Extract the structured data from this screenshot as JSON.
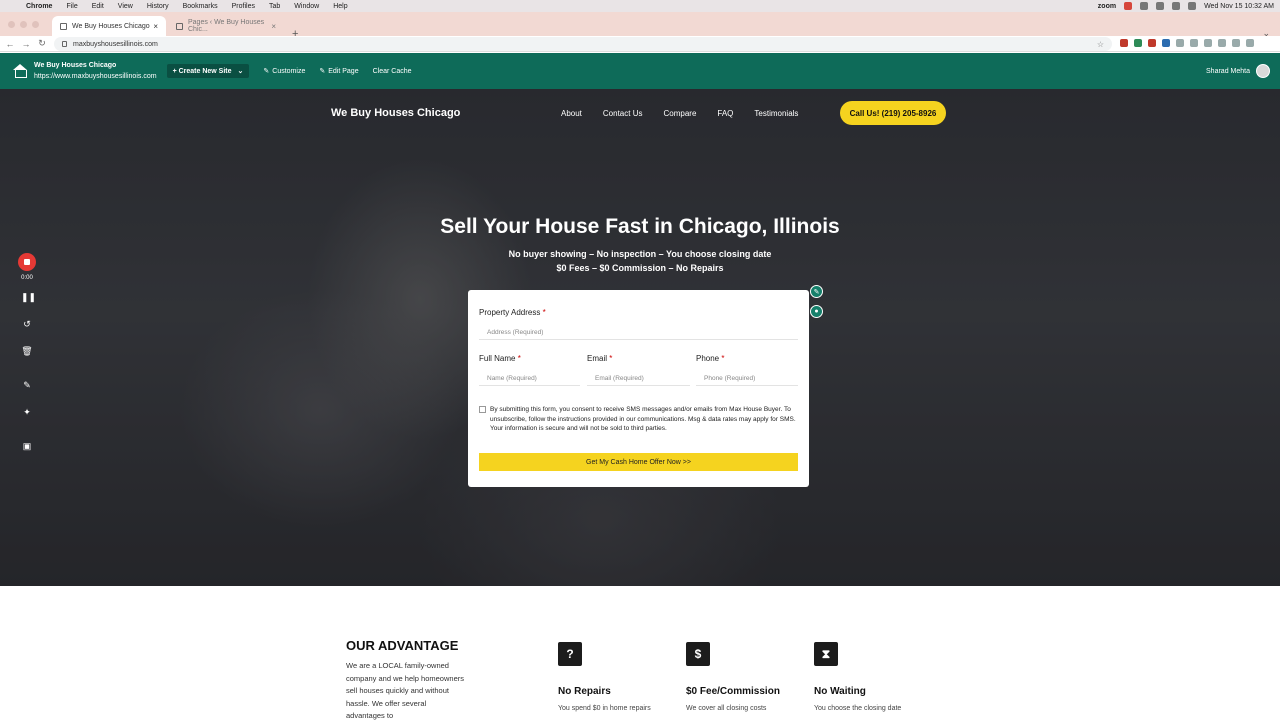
{
  "menubar": {
    "app": "Chrome",
    "items": [
      "File",
      "Edit",
      "View",
      "History",
      "Bookmarks",
      "Profiles",
      "Tab",
      "Window",
      "Help"
    ],
    "zoom_label": "zoom",
    "datetime": "Wed Nov 15  10:32 AM"
  },
  "tabs": [
    {
      "label": "We Buy Houses Chicago",
      "active": true
    },
    {
      "label": "Pages ‹ We Buy Houses Chic...",
      "active": false
    }
  ],
  "browser": {
    "url": "maxbuyshousesillinois.com"
  },
  "adminbar": {
    "site_name": "We Buy Houses Chicago",
    "site_url": "https://www.maxbuyshousesillinois.com",
    "create_label": "Create New Site",
    "customize_label": "Customize",
    "edit_label": "Edit Page",
    "cache_label": "Clear Cache",
    "user_name": "Sharad Mehta"
  },
  "site": {
    "logo": "We Buy Houses Chicago",
    "nav": [
      "About",
      "Contact Us",
      "Compare",
      "FAQ",
      "Testimonials"
    ],
    "call_label": "Call Us! (219) 205-8926"
  },
  "hero": {
    "title": "Sell Your House Fast in Chicago, Illinois",
    "subtitle1": "No buyer showing – No inspection – You choose closing date",
    "subtitle2": "$0 Fees – $0 Commission – No Repairs"
  },
  "form": {
    "address_label": "Property Address",
    "address_placeholder": "Address (Required)",
    "name_label": "Full Name",
    "name_placeholder": "Name (Required)",
    "email_label": "Email",
    "email_placeholder": "Email (Required)",
    "phone_label": "Phone",
    "phone_placeholder": "Phone (Required)",
    "required_mark": "*",
    "consent": "By submitting this form, you consent to receive SMS messages and/or emails from Max House Buyer. To unsubscribe, follow the instructions provided in our communications. Msg & data rates may apply for SMS. Your information is secure and will not be sold to third parties.",
    "submit_label": "Get My Cash Home Offer Now >>"
  },
  "recorder": {
    "time": "0:00"
  },
  "advantage": {
    "title": "OUR ADVANTAGE",
    "text": "We are a LOCAL family-owned company and we help homeowners sell houses quickly and without hassle. We offer several advantages to",
    "features": [
      {
        "icon": "?",
        "title": "No Repairs",
        "desc": "You spend $0 in home repairs"
      },
      {
        "icon": "$",
        "title": "$0 Fee/Commission",
        "desc": "We cover all closing costs"
      },
      {
        "icon": "⧗",
        "title": "No Waiting",
        "desc": "You choose the closing date"
      }
    ]
  },
  "colors": {
    "admin_green": "#0e6b59",
    "accent_yellow": "#f5d31f",
    "record_red": "#e53935"
  }
}
